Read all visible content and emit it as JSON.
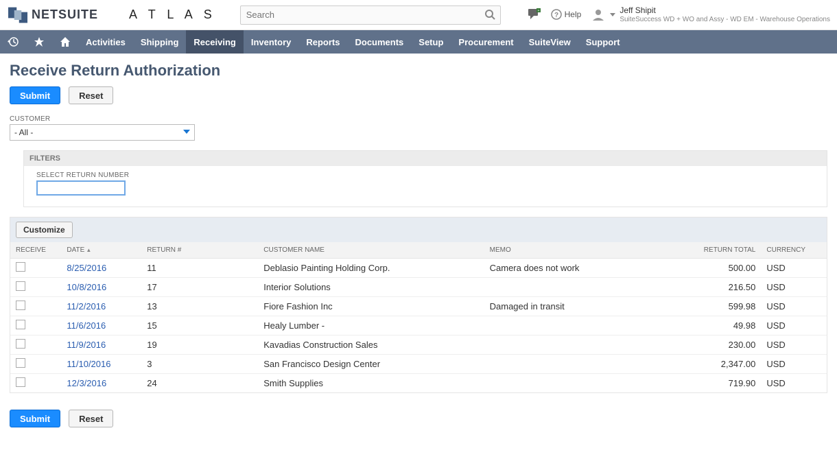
{
  "header": {
    "brand_text": "NETSUITE",
    "secondary_logo": "A T L A S",
    "search_placeholder": "Search",
    "help_label": "Help",
    "user_name": "Jeff Shipit",
    "user_role": "SuiteSuccess WD + WO and Assy - WD EM - Warehouse Operations"
  },
  "nav": {
    "items": [
      "Activities",
      "Shipping",
      "Receiving",
      "Inventory",
      "Reports",
      "Documents",
      "Setup",
      "Procurement",
      "SuiteView",
      "Support"
    ],
    "active_index": 2
  },
  "page": {
    "title": "Receive Return Authorization",
    "submit_label": "Submit",
    "reset_label": "Reset",
    "customer_label": "CUSTOMER",
    "customer_value": "- All -",
    "filters_label": "FILTERS",
    "return_number_label": "SELECT RETURN NUMBER",
    "return_number_value": "",
    "customize_label": "Customize"
  },
  "grid": {
    "columns": {
      "receive": "RECEIVE",
      "date": "DATE",
      "return": "RETURN #",
      "customer": "CUSTOMER NAME",
      "memo": "MEMO",
      "total": "RETURN TOTAL",
      "currency": "CURRENCY"
    },
    "rows": [
      {
        "date": "8/25/2016",
        "return": "11",
        "customer": "Deblasio Painting Holding Corp.",
        "memo": "Camera does not work",
        "total": "500.00",
        "currency": "USD"
      },
      {
        "date": "10/8/2016",
        "return": "17",
        "customer": "Interior Solutions",
        "memo": "",
        "total": "216.50",
        "currency": "USD"
      },
      {
        "date": "11/2/2016",
        "return": "13",
        "customer": "Fiore Fashion Inc",
        "memo": "Damaged in transit",
        "total": "599.98",
        "currency": "USD"
      },
      {
        "date": "11/6/2016",
        "return": "15",
        "customer": "Healy Lumber -",
        "memo": "",
        "total": "49.98",
        "currency": "USD"
      },
      {
        "date": "11/9/2016",
        "return": "19",
        "customer": "Kavadias Construction Sales",
        "memo": "",
        "total": "230.00",
        "currency": "USD"
      },
      {
        "date": "11/10/2016",
        "return": "3",
        "customer": "San Francisco Design Center",
        "memo": "",
        "total": "2,347.00",
        "currency": "USD"
      },
      {
        "date": "12/3/2016",
        "return": "24",
        "customer": "Smith Supplies",
        "memo": "",
        "total": "719.90",
        "currency": "USD"
      }
    ]
  }
}
